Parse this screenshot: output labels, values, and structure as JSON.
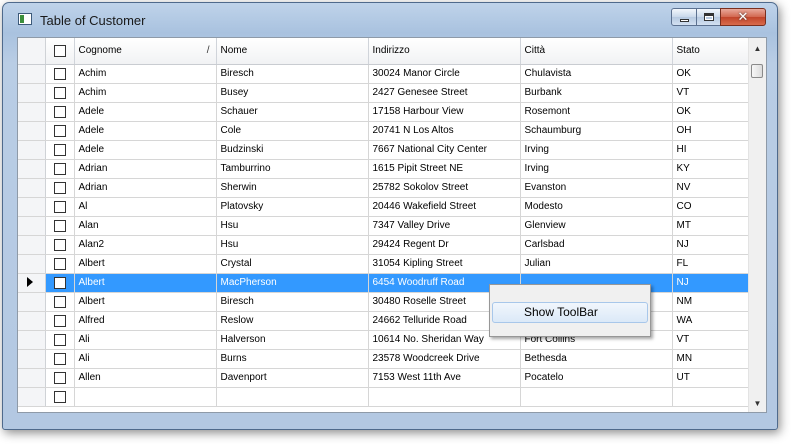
{
  "window": {
    "title": "Table of Customer",
    "controls": {
      "minimize": "minimize-icon",
      "maximize": "maximize-icon",
      "close": "close-icon"
    },
    "close_glyph": "✕"
  },
  "grid": {
    "columns": [
      "",
      "Cognome",
      "Nome",
      "Indirizzo",
      "Città",
      "Stato"
    ],
    "sort_glyph": "/",
    "rows": [
      {
        "cognome": "Achim",
        "nome": "Biresch",
        "indirizzo": "30024 Manor Circle",
        "citta": "Chulavista",
        "stato": "OK",
        "selected": false
      },
      {
        "cognome": "Achim",
        "nome": "Busey",
        "indirizzo": "2427 Genesee Street",
        "citta": "Burbank",
        "stato": "VT",
        "selected": false
      },
      {
        "cognome": "Adele",
        "nome": "Schauer",
        "indirizzo": "17158 Harbour View",
        "citta": "Rosemont",
        "stato": "OK",
        "selected": false
      },
      {
        "cognome": "Adele",
        "nome": "Cole",
        "indirizzo": "20741 N Los Altos",
        "citta": "Schaumburg",
        "stato": "OH",
        "selected": false
      },
      {
        "cognome": "Adele",
        "nome": "Budzinski",
        "indirizzo": "7667 National City Center",
        "citta": "Irving",
        "stato": "HI",
        "selected": false
      },
      {
        "cognome": "Adrian",
        "nome": "Tamburrino",
        "indirizzo": "1615 Pipit Street NE",
        "citta": "Irving",
        "stato": "KY",
        "selected": false
      },
      {
        "cognome": "Adrian",
        "nome": "Sherwin",
        "indirizzo": "25782 Sokolov Street",
        "citta": "Evanston",
        "stato": "NV",
        "selected": false
      },
      {
        "cognome": "Al",
        "nome": "Platovsky",
        "indirizzo": "20446 Wakefield Street",
        "citta": "Modesto",
        "stato": "CO",
        "selected": false
      },
      {
        "cognome": "Alan",
        "nome": "Hsu",
        "indirizzo": "7347 Valley Drive",
        "citta": "Glenview",
        "stato": "MT",
        "selected": false
      },
      {
        "cognome": "Alan2",
        "nome": "Hsu",
        "indirizzo": "29424 Regent Dr",
        "citta": "Carlsbad",
        "stato": "NJ",
        "selected": false
      },
      {
        "cognome": "Albert",
        "nome": "Crystal",
        "indirizzo": "31054 Kipling Street",
        "citta": "Julian",
        "stato": "FL",
        "selected": false
      },
      {
        "cognome": "Albert",
        "nome": "MacPherson",
        "indirizzo": "6454 Woodruff Road",
        "citta": "",
        "stato": "NJ",
        "selected": true
      },
      {
        "cognome": "Albert",
        "nome": "Biresch",
        "indirizzo": "30480 Roselle Street",
        "citta": "",
        "stato": "NM",
        "selected": false
      },
      {
        "cognome": "Alfred",
        "nome": "Reslow",
        "indirizzo": "24662 Telluride Road",
        "citta": "",
        "stato": "WA",
        "selected": false
      },
      {
        "cognome": "Ali",
        "nome": "Halverson",
        "indirizzo": "10614 No. Sheridan Way",
        "citta": "Fort Collins",
        "stato": "VT",
        "selected": false
      },
      {
        "cognome": "Ali",
        "nome": "Burns",
        "indirizzo": "23578 Woodcreek Drive",
        "citta": "Bethesda",
        "stato": "MN",
        "selected": false
      },
      {
        "cognome": "Allen",
        "nome": "Davenport",
        "indirizzo": "7153 West 11th Ave",
        "citta": "Pocatelo",
        "stato": "UT",
        "selected": false
      },
      {
        "cognome": "",
        "nome": "",
        "indirizzo": "",
        "citta": "",
        "stato": "",
        "selected": false
      }
    ]
  },
  "scrollbar": {
    "up_glyph": "▲",
    "down_glyph": "▼"
  },
  "context_menu": {
    "items": [
      "Show ToolBar"
    ]
  }
}
